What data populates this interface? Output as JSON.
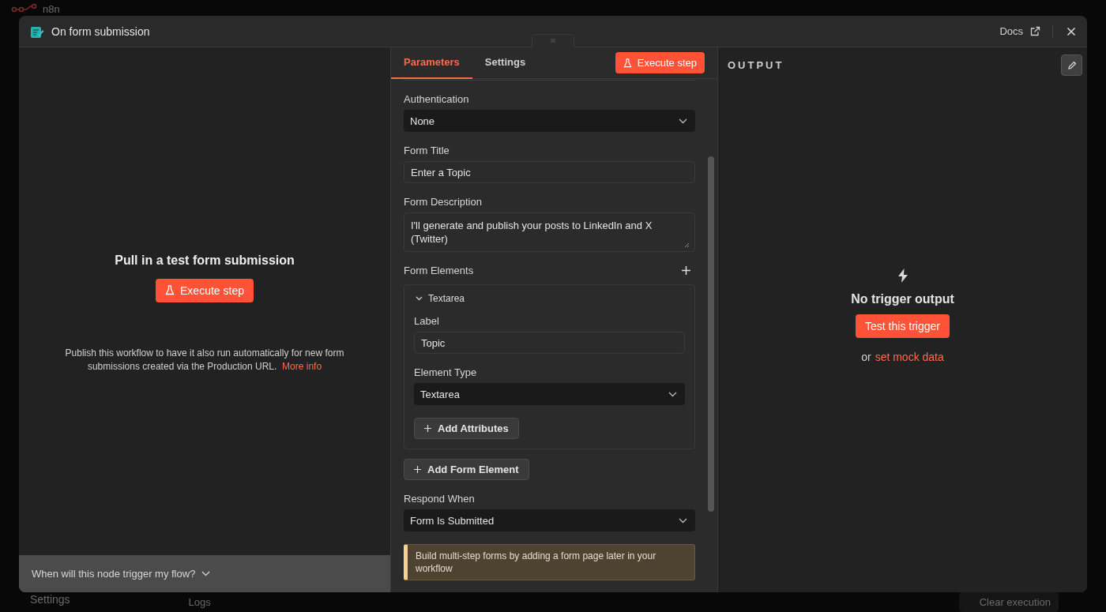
{
  "background": {
    "logo": "n8n",
    "nav_settings": "Settings",
    "logs_tab": "Logs",
    "clear_execution": "Clear execution"
  },
  "window": {
    "title": "On form submission",
    "docs_link": "Docs"
  },
  "left_panel": {
    "heading": "Pull in a test form submission",
    "execute_button": "Execute step",
    "note": "Publish this workflow to have it also run automatically for new form submissions created via the Production URL.",
    "more_info_link": "More info",
    "footer_toggle": "When will this node trigger my flow?"
  },
  "tabs": [
    {
      "label": "Parameters",
      "selected": true
    },
    {
      "label": "Settings",
      "selected": false
    }
  ],
  "execute_button": "Execute step",
  "parameters": [
    {
      "kind": "select",
      "label": "Authentication",
      "value": "None"
    },
    {
      "kind": "input",
      "label": "Form Title",
      "value": "Enter a Topic"
    },
    {
      "kind": "textarea",
      "label": "Form Description",
      "value": "I'll generate and publish your posts to LinkedIn and X (Twitter)"
    }
  ],
  "form_elements": {
    "label": "Form Elements",
    "items": [
      {
        "title": "Textarea",
        "expanded": true,
        "fields": [
          {
            "kind": "input",
            "label": "Label",
            "value": "Topic"
          },
          {
            "kind": "select",
            "label": "Element Type",
            "value": "Textarea"
          }
        ],
        "add_attributes": "Add Attributes"
      }
    ],
    "add_button": "Add Form Element"
  },
  "respond_when": {
    "label": "Respond When",
    "value": "Form Is Submitted"
  },
  "notice": "Build multi-step forms by adding a form page later in your workflow",
  "output": {
    "title": "OUTPUT",
    "empty_title": "No trigger output",
    "test_button": "Test this trigger",
    "alt_prefix": "or",
    "mock_link": "set mock data"
  }
}
